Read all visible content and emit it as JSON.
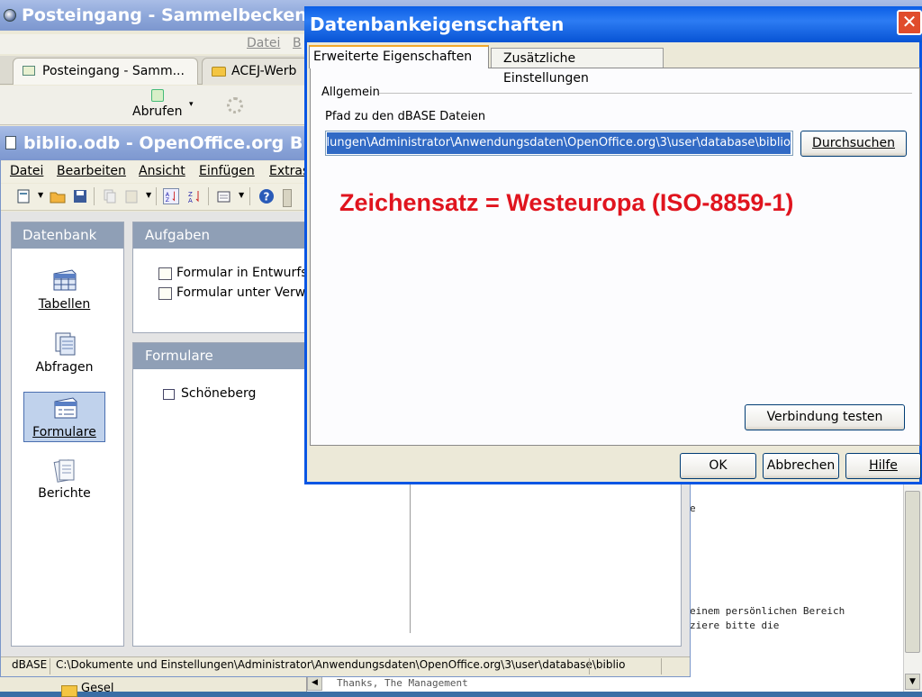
{
  "thunderbird": {
    "window_title": "Posteingang - Sammelbecken",
    "menu": [
      "Datei",
      "B"
    ],
    "tabs": [
      {
        "label": "Posteingang - Samm..."
      },
      {
        "label": "ACEJ-Werb"
      }
    ],
    "toolbar": {
      "abrufen_label": "Abrufen",
      "dropdown_arrow": "▾"
    },
    "folder_gesel": "Gesel",
    "message_lines": [
      "einem persönlichen Bereich",
      "ziere bitte die",
      "Thanks, The Management"
    ],
    "stray_char": "e",
    "scroll_down_arrow": "▼",
    "scroll_left_arrow": "◀"
  },
  "openoffice": {
    "window_title": "biblio.odb - OpenOffice.org B",
    "menu": {
      "datei": "Datei",
      "bearbeiten": "Bearbeiten",
      "ansicht": "Ansicht",
      "einfuegen": "Einfügen",
      "extras": "Extras"
    },
    "left_panel": {
      "header": "Datenbank",
      "items": [
        {
          "label": "Tabellen",
          "icon": "table-icon"
        },
        {
          "label": "Abfragen",
          "icon": "query-icon"
        },
        {
          "label": "Formulare",
          "icon": "form-icon",
          "selected": true
        },
        {
          "label": "Berichte",
          "icon": "report-icon"
        }
      ]
    },
    "tasks": {
      "header": "Aufgaben",
      "items": [
        "Formular in Entwurfsa",
        "Formular unter Verwe"
      ]
    },
    "forms": {
      "header": "Formulare",
      "items": [
        "Schöneberg"
      ]
    },
    "status": {
      "type": "dBASE",
      "path": "C:\\Dokumente und Einstellungen\\Administrator\\Anwendungsdaten\\OpenOffice.org\\3\\user\\database\\biblio"
    }
  },
  "dialog": {
    "title": "Datenbankeigenschaften",
    "close_glyph": "✕",
    "tabs": [
      "Erweiterte Eigenschaften",
      "Zusätzliche Einstellungen"
    ],
    "group_label": "Allgemein",
    "path_label": "Pfad zu den dBASE Dateien",
    "path_value": "lungen\\Administrator\\Anwendungsdaten\\OpenOffice.org\\3\\user\\database\\biblio",
    "browse_button": "Durchsuchen",
    "annotation": "Zeichensatz = Westeuropa (ISO-8859-1)",
    "test_button": "Verbindung testen",
    "ok_button": "OK",
    "cancel_button": "Abbrechen",
    "help_button": "Hilfe",
    "annotation_color": "#e0141e",
    "title_color": "#0a5ee6"
  }
}
